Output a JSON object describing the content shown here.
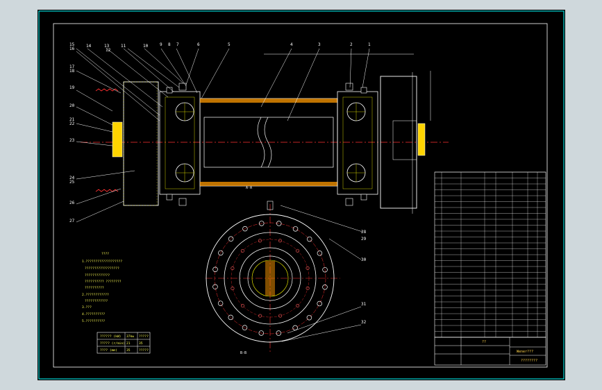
{
  "balloons": {
    "n1": "1",
    "n2": "2",
    "n3": "3",
    "n4": "4",
    "n5": "5",
    "n6": "6",
    "n7": "7",
    "n8": "8",
    "n9": "9",
    "n10": "10",
    "n11": "11",
    "n12": "12",
    "n13": "13",
    "n14": "14",
    "n15": "15",
    "n16": "16",
    "n17": "17",
    "n18": "18",
    "n19": "19",
    "n20": "20",
    "n21": "21",
    "n22": "22",
    "n23": "23",
    "n24": "24",
    "n25": "25",
    "n26": "26",
    "n27": "27",
    "n28": "28",
    "n29": "29",
    "n30": "30",
    "n31": "31",
    "n32": "32"
  },
  "section_labels": {
    "aa": "A-A",
    "bb": "B-B"
  },
  "notes": {
    "heading": "????",
    "lines": [
      "1.???????????????????",
      "??????????????????",
      "?????????????",
      "?????????? ????????",
      "??????????",
      "2.????????????",
      "????????????",
      "3.???",
      "4.??????????",
      "5.??????????"
    ]
  },
  "spec_table": [
    [
      "?????? (kW)",
      "37kw",
      "?????"
    ],
    [
      "????? (r/min)",
      "21",
      "35"
    ],
    [
      "???? (mm)",
      "35",
      "?????"
    ]
  ],
  "title_block": {
    "name": "??",
    "code": "Wener???",
    "drawing_title": "????????"
  }
}
